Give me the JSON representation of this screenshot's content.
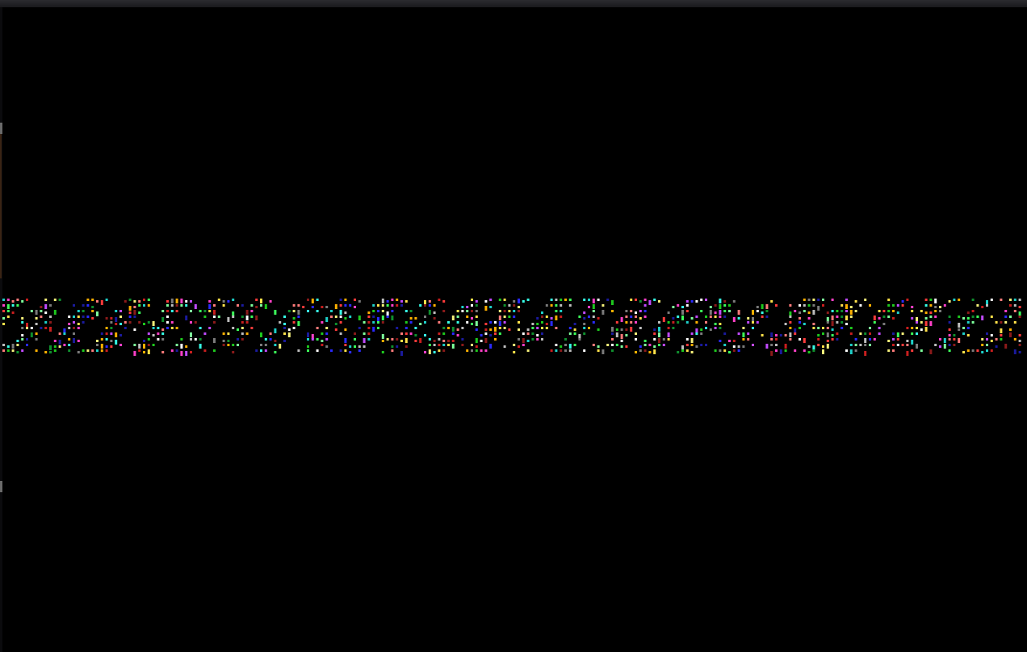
{
  "app": {
    "title": ""
  },
  "canvas": {
    "background": "#000000",
    "window_frame_color": "#2b2b2f",
    "pattern_name": "colored-pixel-band",
    "palette": [
      "#ff3b3b",
      "#c81e1e",
      "#8b1a1a",
      "#ff7a7a",
      "#ffe14a",
      "#ffb000",
      "#f5f07a",
      "#1ec81e",
      "#3cff5a",
      "#0f8f2e",
      "#7dff9a",
      "#2a2aff",
      "#1a1a9c",
      "#ff40c8",
      "#c04aff",
      "#37ffe6",
      "#1ecfc8",
      "#ffffff",
      "#bdbdbd",
      "#7a7a7a"
    ]
  }
}
